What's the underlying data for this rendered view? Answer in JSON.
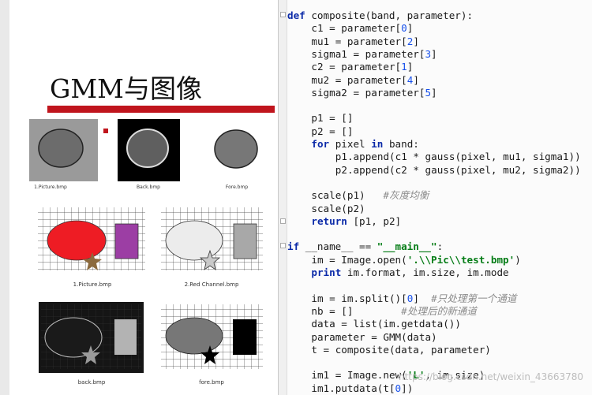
{
  "slide": {
    "title": "GMM与图像",
    "row1": [
      {
        "caption": "1.Picture.bmp"
      },
      {
        "caption": "Back.bmp"
      },
      {
        "caption": "Fore.bmp"
      }
    ],
    "grid": [
      {
        "caption": "1.Picture.bmp"
      },
      {
        "caption": "2.Red Channel.bmp"
      },
      {
        "caption": "back.bmp"
      },
      {
        "caption": "fore.bmp"
      }
    ]
  },
  "editor": {
    "lines": [
      {
        "indent": 0,
        "tokens": [
          [
            "kw",
            "def"
          ],
          [
            "t",
            " composite(band, parameter):"
          ]
        ]
      },
      {
        "indent": 4,
        "tokens": [
          [
            "t",
            "c1 = parameter["
          ],
          [
            "nm",
            "0"
          ],
          [
            "t",
            "]"
          ]
        ]
      },
      {
        "indent": 4,
        "tokens": [
          [
            "t",
            "mu1 = parameter["
          ],
          [
            "nm",
            "2"
          ],
          [
            "t",
            "]"
          ]
        ]
      },
      {
        "indent": 4,
        "tokens": [
          [
            "t",
            "sigma1 = parameter["
          ],
          [
            "nm",
            "3"
          ],
          [
            "t",
            "]"
          ]
        ]
      },
      {
        "indent": 4,
        "tokens": [
          [
            "t",
            "c2 = parameter["
          ],
          [
            "nm",
            "1"
          ],
          [
            "t",
            "]"
          ]
        ]
      },
      {
        "indent": 4,
        "tokens": [
          [
            "t",
            "mu2 = parameter["
          ],
          [
            "nm",
            "4"
          ],
          [
            "t",
            "]"
          ]
        ]
      },
      {
        "indent": 4,
        "tokens": [
          [
            "t",
            "sigma2 = parameter["
          ],
          [
            "nm",
            "5"
          ],
          [
            "t",
            "]"
          ]
        ]
      },
      {
        "indent": 0,
        "tokens": []
      },
      {
        "indent": 4,
        "tokens": [
          [
            "t",
            "p1 = []"
          ]
        ]
      },
      {
        "indent": 4,
        "tokens": [
          [
            "t",
            "p2 = []"
          ]
        ]
      },
      {
        "indent": 4,
        "tokens": [
          [
            "kw",
            "for"
          ],
          [
            "t",
            " pixel "
          ],
          [
            "kw",
            "in"
          ],
          [
            "t",
            " band:"
          ]
        ]
      },
      {
        "indent": 8,
        "tokens": [
          [
            "t",
            "p1.append(c1 * gauss(pixel, mu1, sigma1))"
          ]
        ]
      },
      {
        "indent": 8,
        "tokens": [
          [
            "t",
            "p2.append(c2 * gauss(pixel, mu2, sigma2))"
          ]
        ]
      },
      {
        "indent": 0,
        "tokens": []
      },
      {
        "indent": 4,
        "tokens": [
          [
            "t",
            "scale(p1)   "
          ],
          [
            "cm",
            "#灰度均衡"
          ]
        ]
      },
      {
        "indent": 4,
        "tokens": [
          [
            "t",
            "scale(p2)"
          ]
        ]
      },
      {
        "indent": 4,
        "tokens": [
          [
            "kw",
            "return"
          ],
          [
            "t",
            " [p1, p2]"
          ]
        ]
      },
      {
        "indent": 0,
        "tokens": []
      },
      {
        "indent": 0,
        "tokens": [
          [
            "kw",
            "if"
          ],
          [
            "t",
            " __name__ == "
          ],
          [
            "st",
            "\"__main__\""
          ],
          [
            "t",
            ":"
          ]
        ]
      },
      {
        "indent": 4,
        "tokens": [
          [
            "t",
            "im = Image.open("
          ],
          [
            "st",
            "'.\\\\Pic\\\\test.bmp'"
          ],
          [
            "t",
            ")"
          ]
        ]
      },
      {
        "indent": 4,
        "tokens": [
          [
            "kw",
            "print"
          ],
          [
            "t",
            " im.format, im.size, im.mode"
          ]
        ]
      },
      {
        "indent": 0,
        "tokens": []
      },
      {
        "indent": 4,
        "tokens": [
          [
            "t",
            "im = im.split()["
          ],
          [
            "nm",
            "0"
          ],
          [
            "t",
            "]  "
          ],
          [
            "cm",
            "#只处理第一个通道"
          ]
        ]
      },
      {
        "indent": 4,
        "tokens": [
          [
            "t",
            "nb = []        "
          ],
          [
            "cm",
            "#处理后的新通道"
          ]
        ]
      },
      {
        "indent": 4,
        "tokens": [
          [
            "t",
            "data = "
          ],
          [
            "bi",
            "list"
          ],
          [
            "t",
            "(im.getdata())"
          ]
        ]
      },
      {
        "indent": 4,
        "tokens": [
          [
            "t",
            "parameter = GMM(data)"
          ]
        ]
      },
      {
        "indent": 4,
        "tokens": [
          [
            "t",
            "t = composite(data, parameter)"
          ]
        ]
      },
      {
        "indent": 0,
        "tokens": []
      },
      {
        "indent": 4,
        "tokens": [
          [
            "t",
            "im1 = Image.new("
          ],
          [
            "st",
            "'L'"
          ],
          [
            "t",
            ", im.size)"
          ]
        ]
      },
      {
        "indent": 4,
        "tokens": [
          [
            "t",
            "im1.putdata(t["
          ],
          [
            "nm",
            "0"
          ],
          [
            "t",
            "])"
          ]
        ]
      }
    ]
  },
  "watermark": "https://blog.csdn.net/weixin_43663780"
}
